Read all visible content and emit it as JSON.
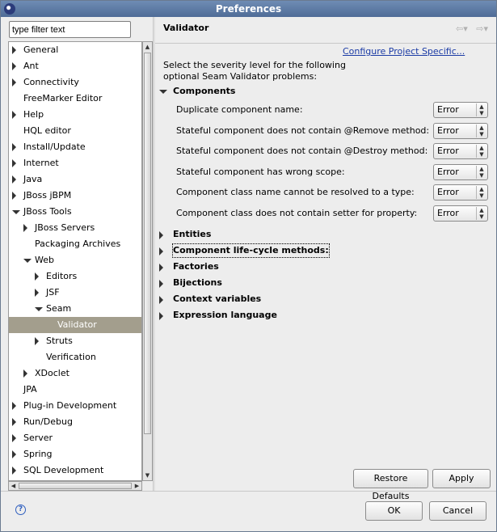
{
  "window": {
    "title": "Preferences"
  },
  "filter": {
    "value": "type filter text"
  },
  "tree": [
    {
      "label": "General",
      "depth": 0,
      "state": "closed"
    },
    {
      "label": "Ant",
      "depth": 0,
      "state": "closed"
    },
    {
      "label": "Connectivity",
      "depth": 0,
      "state": "closed"
    },
    {
      "label": "FreeMarker Editor",
      "depth": 0,
      "state": "none"
    },
    {
      "label": "Help",
      "depth": 0,
      "state": "closed"
    },
    {
      "label": "HQL editor",
      "depth": 0,
      "state": "none"
    },
    {
      "label": "Install/Update",
      "depth": 0,
      "state": "closed"
    },
    {
      "label": "Internet",
      "depth": 0,
      "state": "closed"
    },
    {
      "label": "Java",
      "depth": 0,
      "state": "closed"
    },
    {
      "label": "JBoss jBPM",
      "depth": 0,
      "state": "closed"
    },
    {
      "label": "JBoss Tools",
      "depth": 0,
      "state": "open"
    },
    {
      "label": "JBoss Servers",
      "depth": 1,
      "state": "closed"
    },
    {
      "label": "Packaging Archives",
      "depth": 1,
      "state": "none"
    },
    {
      "label": "Web",
      "depth": 1,
      "state": "open"
    },
    {
      "label": "Editors",
      "depth": 2,
      "state": "closed"
    },
    {
      "label": "JSF",
      "depth": 2,
      "state": "closed"
    },
    {
      "label": "Seam",
      "depth": 2,
      "state": "open"
    },
    {
      "label": "Validator",
      "depth": 3,
      "state": "none",
      "selected": true
    },
    {
      "label": "Struts",
      "depth": 2,
      "state": "closed"
    },
    {
      "label": "Verification",
      "depth": 2,
      "state": "none"
    },
    {
      "label": "XDoclet",
      "depth": 1,
      "state": "closed"
    },
    {
      "label": "JPA",
      "depth": 0,
      "state": "none"
    },
    {
      "label": "Plug-in Development",
      "depth": 0,
      "state": "closed"
    },
    {
      "label": "Run/Debug",
      "depth": 0,
      "state": "closed"
    },
    {
      "label": "Server",
      "depth": 0,
      "state": "closed"
    },
    {
      "label": "Spring",
      "depth": 0,
      "state": "closed"
    },
    {
      "label": "SQL Development",
      "depth": 0,
      "state": "closed"
    }
  ],
  "page": {
    "title": "Validator",
    "config_link": "Configure Project Specific...",
    "description": "Select the severity level for the following optional Seam Validator problems:",
    "components_section": "Components",
    "options": [
      {
        "label": "Duplicate component name:",
        "value": "Error"
      },
      {
        "label": "Stateful component does not contain @Remove method:",
        "value": "Error"
      },
      {
        "label": "Stateful component does not contain @Destroy method:",
        "value": "Error"
      },
      {
        "label": "Stateful component has wrong scope:",
        "value": "Error"
      },
      {
        "label": "Component class name cannot be resolved to a type:",
        "value": "Error"
      },
      {
        "label": "Component class does not contain setter for property:",
        "value": "Error"
      }
    ],
    "collapsed_sections": [
      "Entities",
      "Component life-cycle methods:",
      "Factories",
      "Bijections",
      "Context variables",
      "Expression language"
    ]
  },
  "buttons": {
    "restore": "Restore Defaults",
    "apply": "Apply",
    "ok": "OK",
    "cancel": "Cancel"
  },
  "icons": {
    "help": "?",
    "nav_back": "⇦▾",
    "nav_forward": "⇨▾"
  }
}
